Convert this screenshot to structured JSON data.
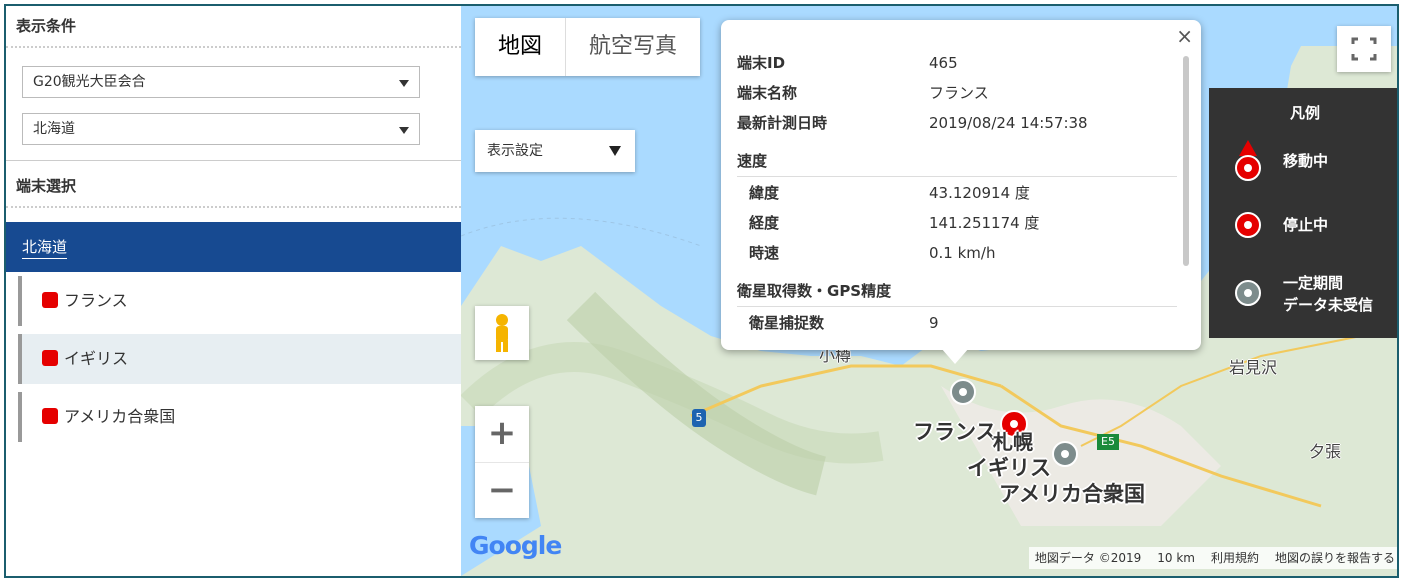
{
  "left_panel": {
    "display_conditions_title": "表示条件",
    "event_select": "G20観光大臣会合",
    "region_select": "北海道",
    "device_select_title": "端末選択",
    "group": "北海道",
    "devices": [
      "フランス",
      "イギリス",
      "アメリカ合衆国"
    ],
    "selected_device_index": 1
  },
  "map": {
    "type_tabs": [
      "地図",
      "航空写真"
    ],
    "display_settings": "表示設定",
    "zoom_in": "+",
    "zoom_out": "−",
    "places": [
      "小樽",
      "岩見沢",
      "夕張",
      "札幌"
    ],
    "road_labels": [
      "5",
      "E5"
    ],
    "markers": [
      "フランス",
      "イギリス",
      "アメリカ合衆国"
    ],
    "google_logo": "Google",
    "attribution": [
      "地図データ ©2019",
      "10 km",
      "利用規約",
      "地図の誤りを報告する"
    ]
  },
  "legend": {
    "title": "凡例",
    "items": [
      {
        "label": "移動中",
        "icon": "moving-marker-icon"
      },
      {
        "label": "停止中",
        "icon": "stopped-marker-icon"
      },
      {
        "label": "一定期間",
        "label2": "データ未受信",
        "icon": "no-data-marker-icon"
      }
    ]
  },
  "popup": {
    "close": "×",
    "terminal_id_label": "端末ID",
    "terminal_id": "465",
    "terminal_name_label": "端末名称",
    "terminal_name": "フランス",
    "latest_time_label": "最新計測日時",
    "latest_time": "2019/08/24 14:57:38",
    "speed_section": "速度",
    "lat_label": "緯度",
    "lat": "43.120914 度",
    "lon_label": "経度",
    "lon": "141.251174 度",
    "speed_label": "時速",
    "speed": "0.1 km/h",
    "gps_section": "衛星取得数・GPS精度",
    "sat_label": "衛星捕捉数",
    "sat": "9"
  },
  "colors": {
    "group_bg": "#174a91",
    "marker_red": "#e50000",
    "legend_bg": "#333333",
    "sea": "#aadaff"
  }
}
